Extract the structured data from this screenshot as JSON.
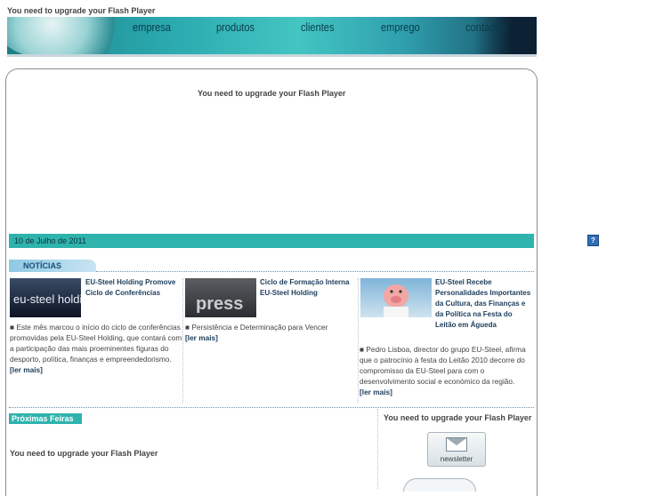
{
  "flash_notice": "You need to upgrade your Flash Player",
  "nav": {
    "items": [
      "empresa",
      "produtos",
      "clientes",
      "emprego",
      "contactos"
    ]
  },
  "date_bar": "10 de Julho de 2011",
  "noticias_label": "NOTÍCIAS",
  "news": [
    {
      "thumb_text": "eu-steel holding",
      "title": "EU-Steel Holding Promove Ciclo de Conferências",
      "body": "■ Este mês marcou o início do ciclo de conferências promovidas pela EU-Steel Holding, que contará com a participação das mais proeminentes figuras do desporto, política, finanças e empreendedorismo.",
      "more": "[ler mais]"
    },
    {
      "thumb_text": "press",
      "title": "Ciclo de Formação Interna EU-Steel Holding",
      "body": "■ Persistência e Determinação para Vencer",
      "more": "[ler mais]"
    },
    {
      "thumb_text": "",
      "title": "EU-Steel Recebe Personalidades Importantes da Cultura, das Finanças e da Política na Festa do Leitão em Águeda",
      "body": "■ Pedro Lisboa, director do grupo EU-Steel, afirma que o patrocínio à festa do Leitão 2010 decorre do compromisso da EU-Steel para com o desenvolvimento social e económico da região.",
      "more": "[ler mais]"
    }
  ],
  "feiras_label": "Próximas Feiras",
  "newsletter_label": "newsletter",
  "help_glyph": "?",
  "colors": {
    "teal": "#2fb3ad",
    "navy": "#1b3c5c"
  }
}
